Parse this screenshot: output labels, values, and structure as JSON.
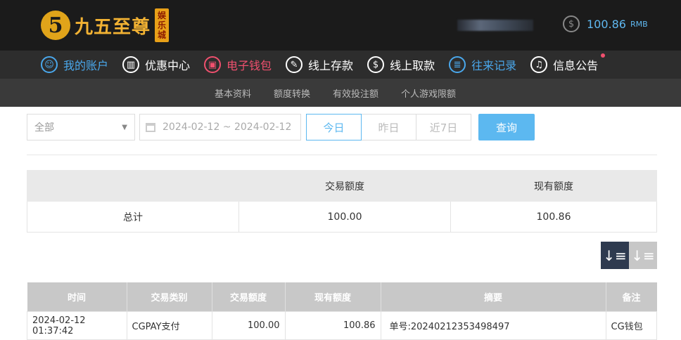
{
  "brand": {
    "logo_mark": "5",
    "name": "九五至尊",
    "sub": [
      "娱",
      "乐",
      "城"
    ]
  },
  "header": {
    "balance": "100.86",
    "currency": "RMB",
    "dollar_icon": "$"
  },
  "nav": [
    {
      "label": "我的账户",
      "icon": "user-icon",
      "glyph": "☺",
      "color": "#4aa8ec"
    },
    {
      "label": "优惠中心",
      "icon": "gift-icon",
      "glyph": "▥",
      "color": "#ffffff"
    },
    {
      "label": "电子钱包",
      "icon": "wallet-icon",
      "glyph": "▣",
      "color": "#f0506e"
    },
    {
      "label": "线上存款",
      "icon": "deposit-icon",
      "glyph": "✎",
      "color": "#ffffff"
    },
    {
      "label": "线上取款",
      "icon": "withdraw-icon",
      "glyph": "$",
      "color": "#ffffff"
    },
    {
      "label": "往来记录",
      "icon": "records-icon",
      "glyph": "≣",
      "color": "#4aa8ec"
    },
    {
      "label": "信息公告",
      "icon": "bell-icon",
      "glyph": "♫",
      "color": "#ffffff"
    }
  ],
  "subnav": [
    "基本资料",
    "额度转换",
    "有效投注额",
    "个人游戏限额"
  ],
  "filters": {
    "type_select": "全部",
    "date_range": "2024-02-12 ~ 2024-02-12",
    "quick": [
      "今日",
      "昨日",
      "近7日"
    ],
    "query": "查询"
  },
  "summary": {
    "headers": [
      "",
      "交易额度",
      "现有额度"
    ],
    "row": [
      "总计",
      "100.00",
      "100.86"
    ]
  },
  "table": {
    "headers": [
      "时间",
      "交易类别",
      "交易额度",
      "现有额度",
      "摘要",
      "备注"
    ],
    "rows": [
      [
        "2024-02-12 01:37:42",
        "CGPAY支付",
        "100.00",
        "100.86",
        "单号:20240212353498497",
        "CG钱包"
      ]
    ]
  }
}
